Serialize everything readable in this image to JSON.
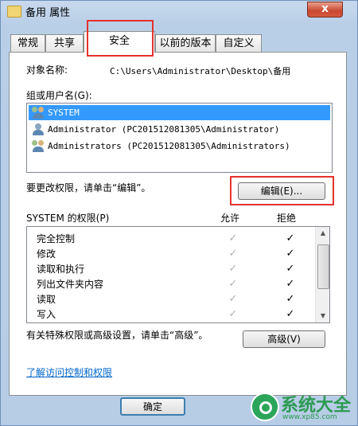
{
  "window": {
    "title": "备用 属性",
    "close_label": "x"
  },
  "tabs": [
    {
      "label": "常规"
    },
    {
      "label": "共享"
    },
    {
      "label": "安全"
    },
    {
      "label": "以前的版本"
    },
    {
      "label": "自定义"
    }
  ],
  "object": {
    "label": "对象名称:",
    "path": "C:\\Users\\Administrator\\Desktop\\备用"
  },
  "groups": {
    "label": "组或用户名(G):",
    "items": [
      {
        "name": "SYSTEM",
        "selected": true
      },
      {
        "name": "Administrator (PC201512081305\\Administrator)",
        "selected": false
      },
      {
        "name": "Administrators (PC201512081305\\Administrators)",
        "selected": false
      }
    ]
  },
  "edit": {
    "hint": "要更改权限，请单击“编辑”。",
    "button_label": "编辑(E)..."
  },
  "permissions": {
    "title": "SYSTEM 的权限(P)",
    "allow_header": "允许",
    "deny_header": "拒绝",
    "rows": [
      {
        "name": "完全控制",
        "allow": true,
        "deny": true
      },
      {
        "name": "修改",
        "allow": true,
        "deny": true
      },
      {
        "name": "读取和执行",
        "allow": true,
        "deny": true
      },
      {
        "name": "列出文件夹内容",
        "allow": true,
        "deny": true
      },
      {
        "name": "读取",
        "allow": true,
        "deny": true
      },
      {
        "name": "写入",
        "allow": true,
        "deny": true
      }
    ]
  },
  "advanced": {
    "hint": "有关特殊权限或高级设置，请单击“高级”。",
    "button_label": "高级(V)"
  },
  "link": {
    "label": "了解访问控制和权限"
  },
  "footer": {
    "ok_label": "确定"
  },
  "watermark": {
    "text": "系统大全",
    "sub": "www.xp85.com"
  },
  "colors": {
    "highlight": "#e6322e",
    "selection": "#3399ff",
    "link": "#0066cc"
  }
}
